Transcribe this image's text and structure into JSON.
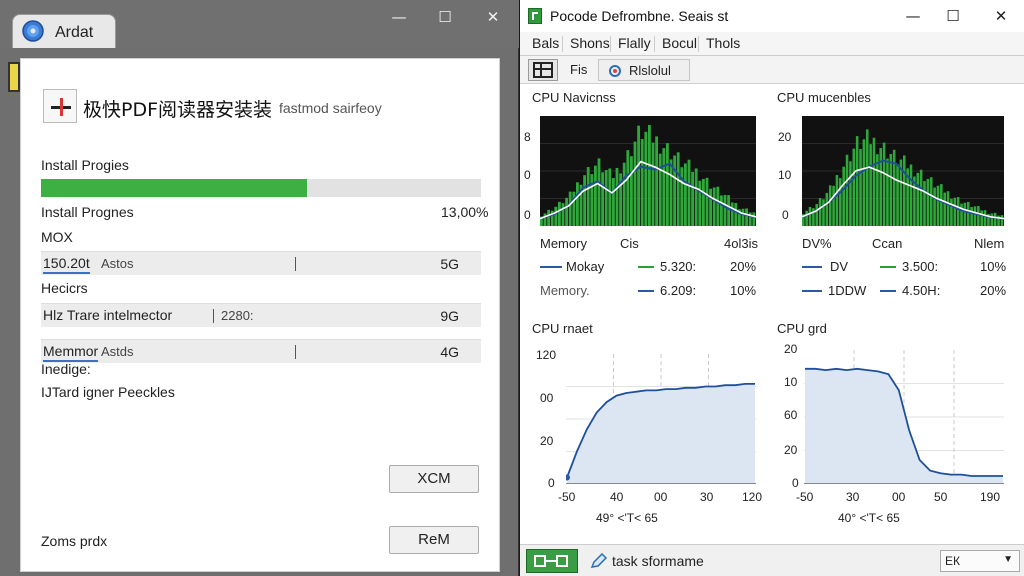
{
  "left_window": {
    "tab_label": "Ardat",
    "controls": {
      "minimize": "—",
      "maximize": "☐",
      "close": "✕"
    },
    "product_title": "极快PDF阅读器安装装",
    "product_subtitle": "fastmod sairfeoy",
    "install_progress_label": "Install Progies",
    "progress": 0.605,
    "progress_label_2": "Install Prognes",
    "progress_value": "13,00%",
    "label_mox": "MOX",
    "rows": [
      {
        "name": "150.20t",
        "desc": "Astos",
        "value": "5G"
      },
      {
        "name": "Hlz Trare intelmector",
        "desc": "2280:",
        "value": "9G"
      },
      {
        "name": "Memmor",
        "desc": "Astds",
        "value": "4G"
      }
    ],
    "label_hecicrs": "Hecicrs",
    "label_inedige": "Inedige:",
    "label_ijt": "IJTard igner Peeckles",
    "button_xcm": "XCM",
    "footer_label": "Zoms prdx",
    "button_rem": "ReM"
  },
  "right_window": {
    "title": "Pocode Defrombne. Seais st",
    "controls": {
      "minimize": "—",
      "maximize": "☐",
      "close": "✕"
    },
    "menu": [
      "Bals",
      "Shons",
      "Flally",
      "Bocul",
      "Thols"
    ],
    "toolbar": {
      "btn1_label": "Fis",
      "btn2_label": "Rlslolul"
    },
    "panels": [
      {
        "title": "CPU Navicnss",
        "y_ticks": [
          "8",
          "0",
          "0"
        ],
        "legend_header": [
          "Memory",
          "Cis",
          "4ol3is"
        ],
        "legend_rows": [
          {
            "name": "Mokay",
            "value": "5.320:",
            "pct": "20%"
          },
          {
            "name": "Memory.",
            "value": "6.209:",
            "pct": "10%"
          }
        ],
        "color_main": "#2b5aa0",
        "color_alt": "#2f9c3a"
      },
      {
        "title": "CPU mucenbles",
        "y_ticks": [
          "20",
          "10",
          "0"
        ],
        "legend_header": [
          "DV%",
          "Ccan",
          "Nlem"
        ],
        "legend_rows": [
          {
            "name": "DV",
            "value": "3.500:",
            "pct": "10%"
          },
          {
            "name": "1DDW",
            "value": "4.50H:",
            "pct": "20%"
          }
        ],
        "color_main": "#2b5aa0",
        "color_alt": "#2f9c3a"
      }
    ],
    "line_charts": [
      {
        "title": "CPU rnaet",
        "y_ticks": [
          "120",
          "00",
          "20",
          "0"
        ],
        "x_ticks": [
          "-50",
          "40",
          "00",
          "30",
          "120"
        ],
        "x_label": "49° <'T< 65"
      },
      {
        "title": "CPU grd",
        "y_ticks": [
          "20",
          "10",
          "60",
          "20",
          "0"
        ],
        "x_ticks": [
          "-50",
          "30",
          "00",
          "50",
          "190"
        ],
        "x_label": "40° <'T< 65"
      }
    ],
    "status": {
      "label": "task sformame",
      "dropdown": "ЕК"
    }
  },
  "chart_data": [
    {
      "type": "area",
      "title": "CPU Navicnss",
      "y_tick_labels": [
        "8",
        "0",
        "0"
      ],
      "series": [
        {
          "name": "Mokay",
          "values": [
            5,
            8,
            14,
            26,
            30,
            22,
            34,
            40,
            38,
            42,
            30,
            24,
            18,
            12,
            8,
            6
          ]
        },
        {
          "name": "Memory.",
          "values": [
            8,
            14,
            22,
            38,
            46,
            36,
            50,
            70,
            64,
            56,
            46,
            40,
            30,
            22,
            14,
            10
          ]
        }
      ]
    },
    {
      "type": "area",
      "title": "CPU mucenbles",
      "y_tick_labels": [
        "20",
        "10",
        "0"
      ],
      "series": [
        {
          "name": "DV",
          "values": [
            6,
            10,
            16,
            24,
            34,
            40,
            44,
            42,
            32,
            24,
            18,
            14,
            10,
            8,
            6,
            5
          ]
        },
        {
          "name": "1DDW",
          "values": [
            10,
            16,
            26,
            44,
            60,
            64,
            58,
            50,
            44,
            38,
            30,
            24,
            18,
            14,
            10,
            8
          ]
        }
      ]
    },
    {
      "type": "area",
      "title": "CPU rnaet",
      "x_tick_labels": [
        "-50",
        "40",
        "00",
        "30",
        "120"
      ],
      "y_tick_labels": [
        "120",
        "00",
        "20",
        "0"
      ],
      "x": [
        0,
        1,
        2,
        3,
        4,
        5,
        6,
        7,
        8,
        9,
        10,
        11,
        12,
        13,
        14,
        15,
        16,
        17,
        18,
        19
      ],
      "values": [
        5,
        25,
        42,
        55,
        63,
        68,
        70,
        71,
        72,
        72,
        73,
        73,
        74,
        74,
        75,
        75,
        76,
        76,
        77,
        77
      ],
      "ylim": [
        0,
        100
      ]
    },
    {
      "type": "area",
      "title": "CPU grd",
      "x_tick_labels": [
        "-50",
        "30",
        "00",
        "50",
        "190"
      ],
      "y_tick_labels": [
        "20",
        "10",
        "60",
        "20",
        "0"
      ],
      "x": [
        0,
        1,
        2,
        3,
        4,
        5,
        6,
        7,
        8,
        9,
        10,
        11,
        12,
        13,
        14,
        15,
        16,
        17,
        18,
        19
      ],
      "values": [
        86,
        86,
        85,
        86,
        85,
        86,
        85,
        84,
        82,
        70,
        40,
        18,
        10,
        8,
        7,
        7,
        6,
        6,
        6,
        6
      ],
      "ylim": [
        0,
        100
      ]
    }
  ]
}
